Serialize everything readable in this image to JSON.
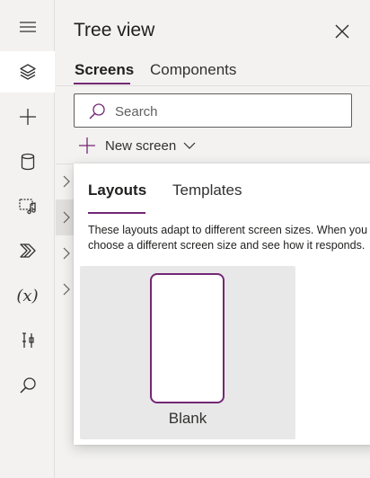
{
  "rail": {
    "items": [
      {
        "icon": "hamburger-menu-icon"
      },
      {
        "icon": "layers-icon",
        "active": true
      },
      {
        "icon": "plus-icon"
      },
      {
        "icon": "database-icon"
      },
      {
        "icon": "media-icon"
      },
      {
        "icon": "power-automate-icon"
      },
      {
        "icon": "variables-icon",
        "glyph": "(x)"
      },
      {
        "icon": "tools-icon"
      },
      {
        "icon": "search-icon"
      }
    ]
  },
  "panel": {
    "title": "Tree view",
    "tabs": [
      {
        "label": "Screens",
        "selected": true
      },
      {
        "label": "Components",
        "selected": false
      }
    ],
    "search": {
      "placeholder": "Search",
      "value": ""
    },
    "new_screen_label": "New screen"
  },
  "flyout": {
    "tabs": [
      {
        "label": "Layouts",
        "selected": true
      },
      {
        "label": "Templates",
        "selected": false
      }
    ],
    "description_lines": [
      "These layouts adapt to different screen sizes. When you",
      "choose a different screen size and see how it responds."
    ],
    "layouts": [
      {
        "label": "Blank"
      }
    ]
  },
  "colors": {
    "accent": "#742774",
    "background": "#f3f2f1",
    "text": "#201f1e"
  }
}
